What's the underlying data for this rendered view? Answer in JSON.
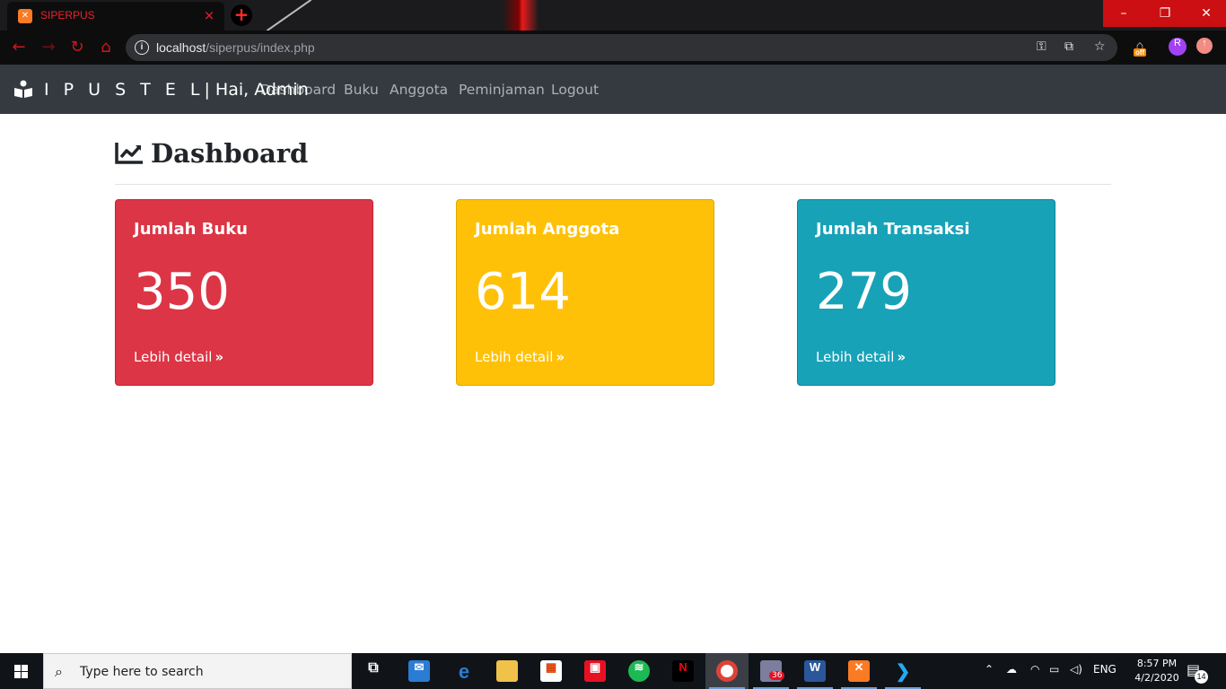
{
  "browser": {
    "tab_title": "SIPERPUS",
    "tab_close": "×",
    "new_tab": "+",
    "url_host": "localhost",
    "url_path": "/siperpus/index.php",
    "ext_badge": "off",
    "profile_initial": "R",
    "window_controls": {
      "minimize": "–",
      "maximize": "❐",
      "close": "✕"
    },
    "accent_color": "#d0161c"
  },
  "navbar": {
    "brand_spaced": "I P U S T E L",
    "brand_rest": "| Hai, Admin",
    "links": [
      "Dashboard",
      "Buku",
      "Anggota",
      "Peminjaman",
      "Logout"
    ],
    "bg_color": "#343a40"
  },
  "page": {
    "title": "Dashboard"
  },
  "cards": [
    {
      "title": "Jumlah Buku",
      "value": "350",
      "link": "Lebih detail",
      "color": "#dc3545"
    },
    {
      "title": "Jumlah Anggota",
      "value": "614",
      "link": "Lebih detail",
      "color": "#ffc107"
    },
    {
      "title": "Jumlah Transaksi",
      "value": "279",
      "link": "Lebih detail",
      "color": "#17a2b8"
    }
  ],
  "taskbar": {
    "search_placeholder": "Type here to search",
    "whatsapp_badge": "36",
    "language": "ENG",
    "time": "8:57 PM",
    "date": "4/2/2020",
    "notification_count": "14"
  }
}
